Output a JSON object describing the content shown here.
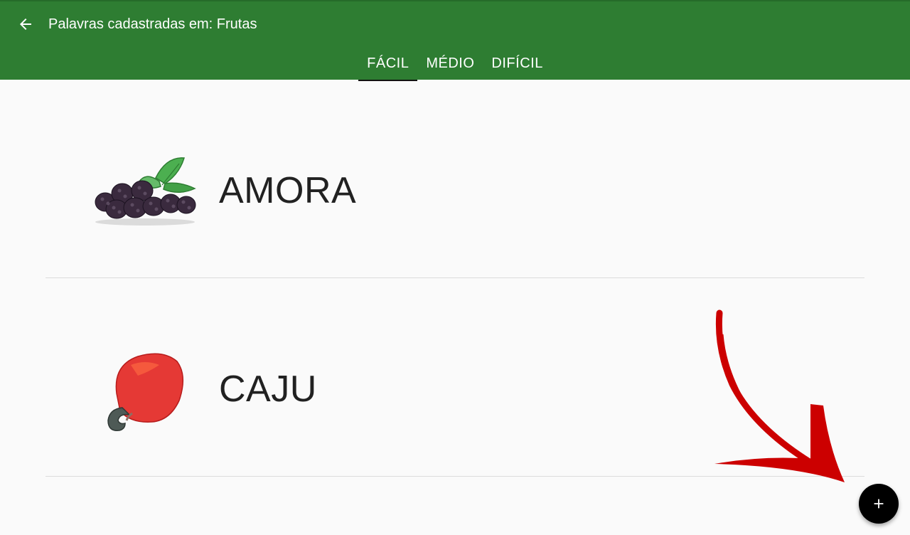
{
  "appbar": {
    "title": "Palavras cadastradas em: Frutas",
    "back_icon": "arrow-left-icon",
    "color": "#2e7d32"
  },
  "tabs": [
    {
      "label": "FÁCIL",
      "active": true
    },
    {
      "label": "MÉDIO",
      "active": false
    },
    {
      "label": "DIFÍCIL",
      "active": false
    }
  ],
  "words": [
    {
      "word": "AMORA",
      "image": "blackberries-image"
    },
    {
      "word": "CAJU",
      "image": "cashew-fruit-image"
    }
  ],
  "annotation": {
    "icon": "red-arrow-annotation",
    "color": "#cc0000"
  },
  "fab": {
    "icon": "plus-icon",
    "color": "#000000"
  }
}
